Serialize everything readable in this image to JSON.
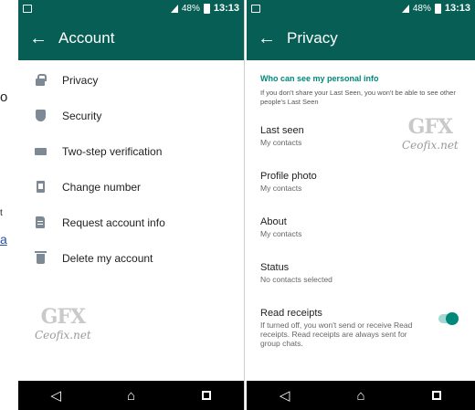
{
  "page_edge": {
    "text_o": "o",
    "text_t": "t",
    "link_a": "a"
  },
  "left_phone": {
    "status": {
      "battery": "48%",
      "time": "13:13"
    },
    "appbar": {
      "back_icon": "arrow-left",
      "title": "Account"
    },
    "menu": [
      {
        "icon": "lock-icon",
        "label": "Privacy"
      },
      {
        "icon": "shield-icon",
        "label": "Security"
      },
      {
        "icon": "dots-icon",
        "label": "Two-step verification"
      },
      {
        "icon": "phone-icon",
        "label": "Change number"
      },
      {
        "icon": "document-icon",
        "label": "Request account info"
      },
      {
        "icon": "trash-icon",
        "label": "Delete my account"
      }
    ],
    "watermark": {
      "logo": "GFX",
      "text": "Ceofix.net"
    }
  },
  "right_phone": {
    "status": {
      "battery": "48%",
      "time": "13:13"
    },
    "appbar": {
      "back_icon": "arrow-left",
      "title": "Privacy"
    },
    "section": {
      "title": "Who can see my personal info",
      "desc": "If you don't share your Last Seen, you won't be able to see other people's Last Seen"
    },
    "items": [
      {
        "title": "Last seen",
        "sub": "My contacts"
      },
      {
        "title": "Profile photo",
        "sub": "My contacts"
      },
      {
        "title": "About",
        "sub": "My contacts"
      },
      {
        "title": "Status",
        "sub": "No contacts selected"
      },
      {
        "title": "Read receipts",
        "sub": "If turned off, you won't send or receive Read receipts. Read receipts are always sent for group chats.",
        "toggle_on": true
      }
    ],
    "watermark": {
      "logo": "GFX",
      "text": "Ceofix.net"
    }
  },
  "colors": {
    "appbar": "#075e54",
    "accent": "#00897b",
    "navbar": "#000000"
  }
}
